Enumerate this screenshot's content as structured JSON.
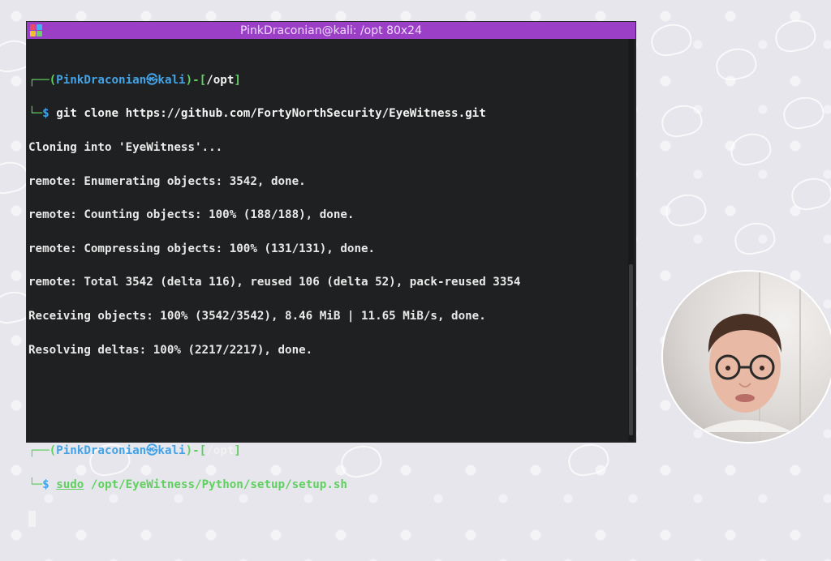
{
  "window": {
    "title": "PinkDraconian@kali: /opt 80x24",
    "accent": "#9b3fc7"
  },
  "prompt": {
    "user": "PinkDraconian",
    "at_icon": "skull-icon",
    "host": "kali",
    "dir": "/opt",
    "dollar": "$"
  },
  "terminal": {
    "cmd1": "git clone https://github.com/FortyNorthSecurity/EyeWitness.git",
    "output": [
      "Cloning into 'EyeWitness'...",
      "remote: Enumerating objects: 3542, done.",
      "remote: Counting objects: 100% (188/188), done.",
      "remote: Compressing objects: 100% (131/131), done.",
      "remote: Total 3542 (delta 116), reused 106 (delta 52), pack-reused 3354",
      "Receiving objects: 100% (3542/3542), 8.46 MiB | 11.65 MiB/s, done.",
      "Resolving deltas: 100% (2217/2217), done."
    ],
    "cmd2_sudo": "sudo",
    "cmd2_rest": " /opt/EyeWitness/Python/setup/setup.sh"
  },
  "colors": {
    "prompt_green": "#5fd05f",
    "prompt_blue": "#43a3e6",
    "terminal_bg": "#1f2021"
  }
}
